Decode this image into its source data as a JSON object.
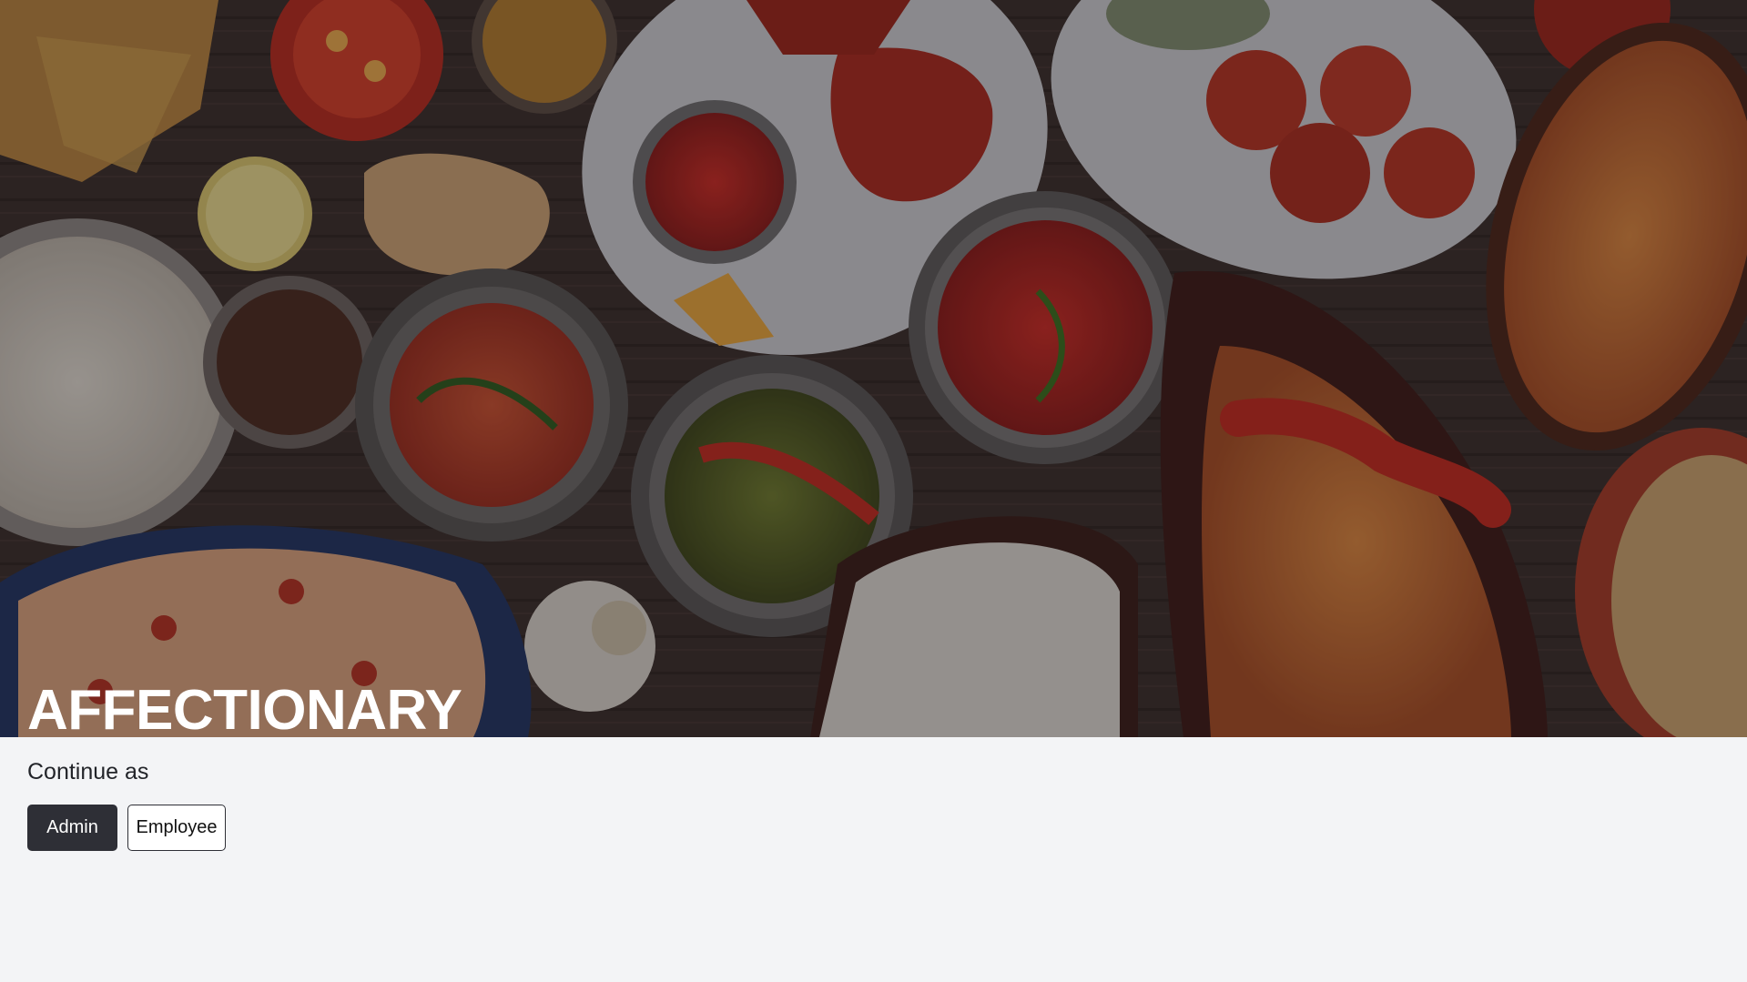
{
  "hero": {
    "brand_title": "AFFECTIONARY",
    "image_description_icon": "food-spread-image"
  },
  "login": {
    "prompt": "Continue as",
    "admin_label": "Admin",
    "employee_label": "Employee"
  },
  "colors": {
    "page_background": "#f3f4f6",
    "primary_button": "#2e2f36",
    "secondary_button": "#ffffff",
    "hero_title": "#ffffff"
  }
}
